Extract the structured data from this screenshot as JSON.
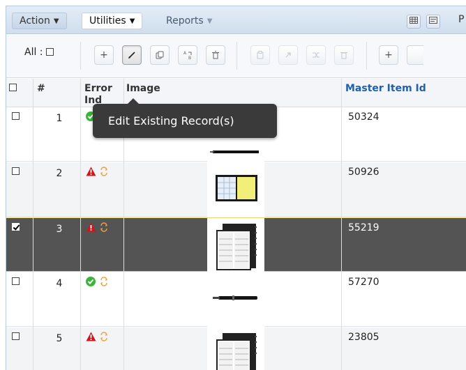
{
  "menubar": {
    "action_label": "Action",
    "utilities_label": "Utilities",
    "reports_label": "Reports",
    "overflow_text": "P"
  },
  "toolbar": {
    "all_label": "All :"
  },
  "grid": {
    "columns": {
      "num": "#",
      "error_ind": "Error Ind",
      "image": "Image",
      "master_item_id": "Master Item Id"
    },
    "rows": [
      {
        "num": "1",
        "master_item_id": "50324",
        "error": "ok",
        "selected": false,
        "image": "pen-icon"
      },
      {
        "num": "2",
        "master_item_id": "50926",
        "error": "warning",
        "selected": false,
        "image": "calendar-planner-icon"
      },
      {
        "num": "3",
        "master_item_id": "55219",
        "error": "warning",
        "selected": true,
        "image": "planner-book-icon"
      },
      {
        "num": "4",
        "master_item_id": "57270",
        "error": "ok",
        "selected": false,
        "image": "pen-icon"
      },
      {
        "num": "5",
        "master_item_id": "23805",
        "error": "warning",
        "selected": false,
        "image": "planner-book-icon"
      }
    ]
  },
  "tooltip": {
    "text": "Edit Existing Record(s)"
  },
  "colors": {
    "link_blue": "#1f5fb0",
    "ok_green": "#3cb43c",
    "warning_red": "#d0141b",
    "sync_orange": "#f0a040",
    "selected_row": "#545454"
  }
}
